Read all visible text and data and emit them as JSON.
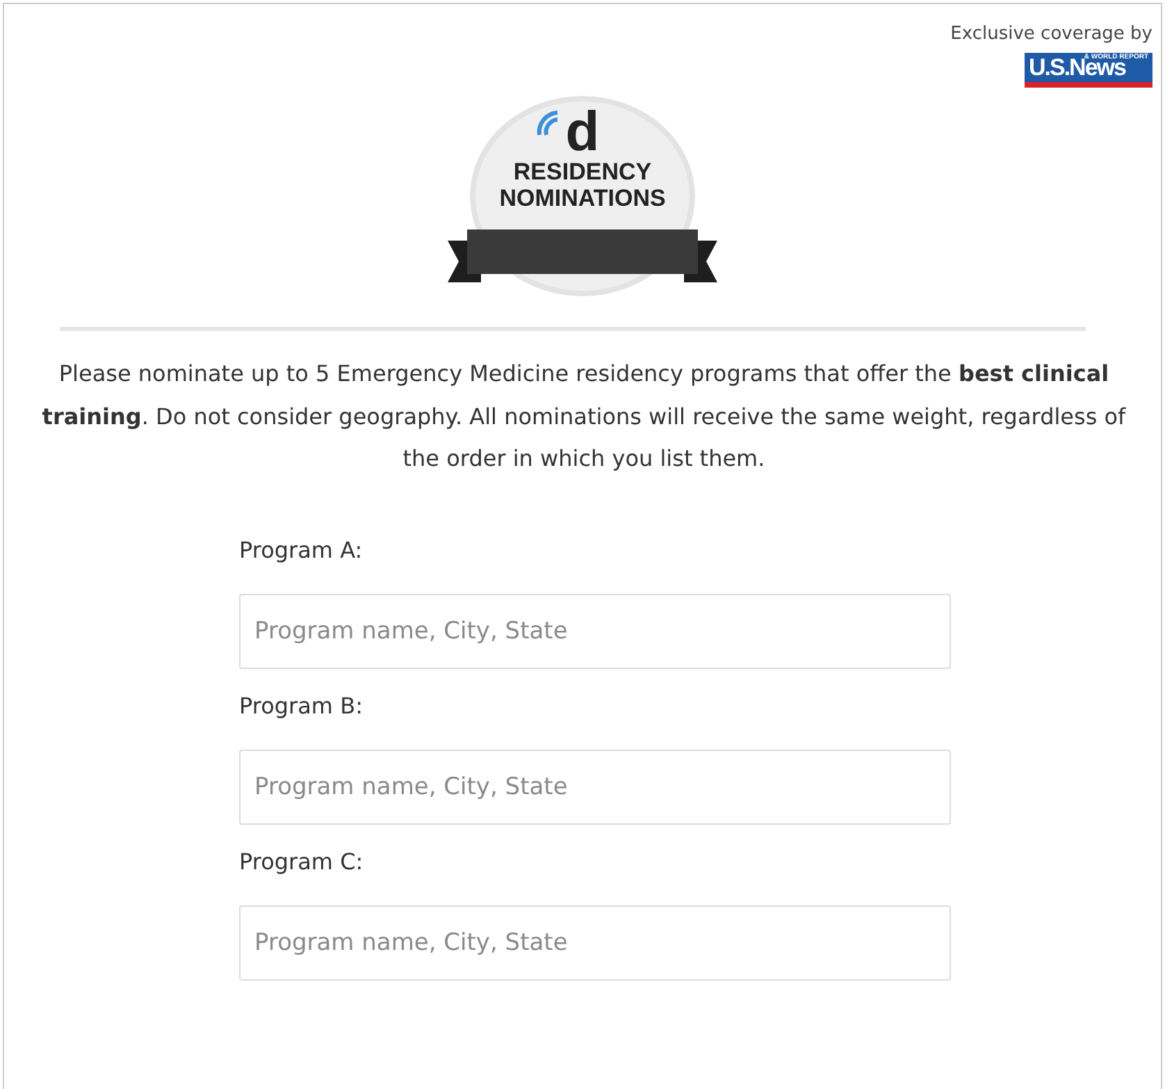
{
  "sponsor": {
    "caption": "Exclusive coverage by",
    "logo_main": "U.S.News",
    "logo_sub": "& WORLD REPORT"
  },
  "badge": {
    "letter": "d",
    "line_1": "RESIDENCY",
    "line_2": "NOMINATIONS"
  },
  "instructions": "Please nominate up to 5 Emergency Medicine residency programs that offer the **best clinical training**. Do not consider geography. All nominations will receive the same weight, regardless of the order in which you list them.",
  "fields": [
    {
      "label": "Program A:",
      "placeholder": "Program name, City, State"
    },
    {
      "label": "Program B:",
      "placeholder": "Program name, City, State"
    },
    {
      "label": "Program C:",
      "placeholder": "Program name, City, State"
    }
  ]
}
